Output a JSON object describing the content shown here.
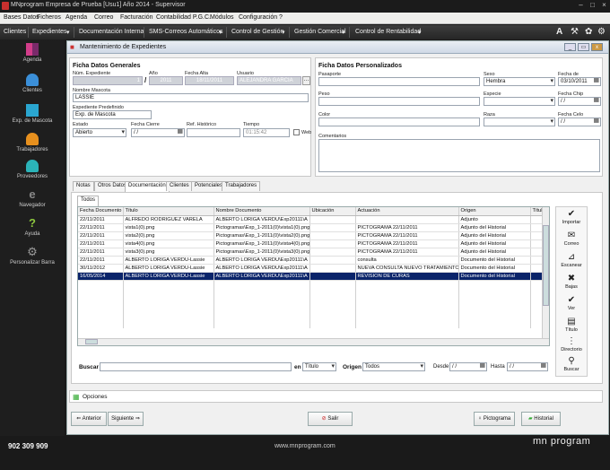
{
  "window": {
    "title": "MNprogram Empresa de Prueba [Usu1] Año 2014 - Supervisor"
  },
  "menu": [
    "Bases Datos",
    "Ficheros",
    "Agenda",
    "Correo",
    "Facturación",
    "Contabilidad P.G.C.",
    "Módulos",
    "Configuración",
    "?"
  ],
  "nav": [
    "Clientes",
    "Expedientes",
    "Documentación Interna",
    "SMS-Correos Automáticos",
    "Control de Gestión",
    "Gestión Comercial",
    "Control de Rentabilidad"
  ],
  "sidebar": [
    "Agenda",
    "Clientes",
    "Exp. de Mascota",
    "Trabajadores",
    "Proveedores",
    "Navegador",
    "Ayuda",
    "Personalizar Barra"
  ],
  "form": {
    "title": "Mantenimiento de Expedientes",
    "general": {
      "heading": "Ficha Datos Generales",
      "num_label": "Núm. Expediente",
      "num": "1",
      "year_label": "Año",
      "year": "2011",
      "fecha_alta_label": "Fecha Alta",
      "fecha_alta": "18/11/2011",
      "usuario_label": "Usuario",
      "usuario": "ALEJANDRA GARCIA",
      "mascota_label": "Nombre Mascota",
      "mascota": "LASSIE",
      "predef_label": "Expediente Predefinido",
      "predef": "Exp. de Mascota",
      "estado_label": "Estado",
      "estado": "Abierto",
      "cierre_label": "Fecha Cierre",
      "cierre": "/ /",
      "ref_label": "Ref. Histórico",
      "tiempo_label": "Tiempo",
      "tiempo": "01:15:42",
      "web_label": "Web"
    },
    "personal": {
      "heading": "Ficha Datos Personalizados",
      "pasaporte": "Pasaporte",
      "sexo_label": "Sexo",
      "sexo": "Hembra",
      "nac_label": "Fecha de Nacimiento",
      "nac": "03/10/2011",
      "peso": "Peso",
      "especie": "Especie",
      "chip_label": "Fecha Chip",
      "chip": "/ /",
      "color": "Color",
      "raza": "Raza",
      "celo_label": "Fecha Celo",
      "celo": "/ /",
      "comentarios": "Comentarios"
    },
    "tabs": [
      "Notas",
      "Otros Datos",
      "Documentación",
      "Clientes",
      "Potenciales",
      "Trabajadores"
    ],
    "subtab": "Todos",
    "grid": {
      "columns": [
        "Fecha Documento",
        "Título",
        "Nombre Documento",
        "Ubicación",
        "Actuación",
        "Origen",
        "Título"
      ],
      "rows": [
        [
          "22/11/2011",
          "ALFREDO RODRIGUEZ VARELA",
          "ALBERTO LORIGA VERDU\\Exp20111\\A",
          "",
          "",
          "Adjunto",
          ""
        ],
        [
          "22/11/2011",
          "vista1(0).png",
          "Pictogramas\\Exp_1-2011(0)\\vista1(0).png",
          "",
          "PICTOGRAMA 22/11/2011",
          "Adjunto del Historial",
          ""
        ],
        [
          "22/11/2011",
          "vista2(0).png",
          "Pictogramas\\Exp_1-2011(0)\\vista2(0).png",
          "",
          "PICTOGRAMA 22/11/2011",
          "Adjunto del Historial",
          ""
        ],
        [
          "22/11/2011",
          "vista4(0).png",
          "Pictogramas\\Exp_1-2011(0)\\vista4(0).png",
          "",
          "PICTOGRAMA 22/11/2011",
          "Adjunto del Historial",
          ""
        ],
        [
          "22/11/2011",
          "vista3(0).png",
          "Pictogramas\\Exp_1-2011(0)\\vista3(0).png",
          "",
          "PICTOGRAMA 22/11/2011",
          "Adjunto del Historial",
          ""
        ],
        [
          "22/11/2011",
          "ALBERTO LORIGA VERDU-Lassie",
          "ALBERTO LORIGA VERDU\\Exp20111\\A",
          "",
          "consulta",
          "Documento del Historial",
          ""
        ],
        [
          "30/11/2012",
          "ALBERTO LORIGA VERDU-Lassie",
          "ALBERTO LORIGA VERDU\\Exp20111\\A",
          "",
          "NUEVA CONSULTA NUEVO TRATAMIENTO",
          "Documento del Historial",
          ""
        ],
        [
          "16/05/2014",
          "ALBERTO LORIGA VERDU-Lassie",
          "ALBERTO LORIGA VERDU\\Exp20111\\A",
          "",
          "REVISION DE CURAS",
          "Documento del Historial",
          ""
        ]
      ],
      "selected_row": 7
    },
    "actions": [
      "Importar",
      "Correo",
      "Escanear",
      "Bajas",
      "Ver",
      "Título",
      "Directorio",
      "Buscar"
    ],
    "search": {
      "label": "Buscar",
      "en_label": "en",
      "en": "Título",
      "origen_label": "Origen",
      "origen": "Todos",
      "desde_label": "Desde",
      "desde": "/ /",
      "hasta_label": "Hasta",
      "hasta": "/ /"
    },
    "opciones": "Opciones",
    "buttons": {
      "anterior": "Anterior",
      "siguiente": "Siguiente",
      "salir": "Salir",
      "pictograma": "Pictograma",
      "historial": "Historial"
    }
  },
  "footer": {
    "phone": "902 309 909",
    "url": "www.mnprogram.com",
    "brand": "mn program"
  }
}
